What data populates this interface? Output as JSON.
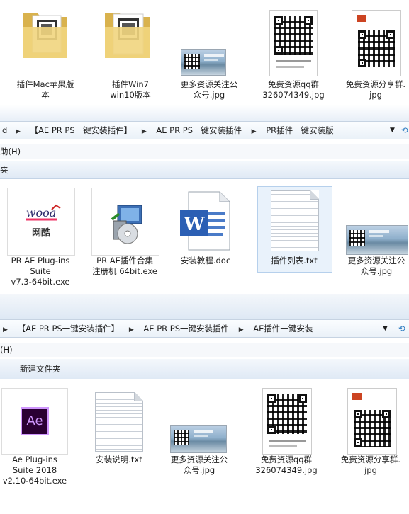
{
  "top": {
    "files": [
      {
        "label": "插件Mac苹果版\n本"
      },
      {
        "label": "插件Win7\nwin10版本"
      },
      {
        "label": "更多资源关注公\n众号.jpg"
      },
      {
        "label": "免费资源qq群\n326074349.jpg"
      },
      {
        "label": "免费资源分享群.\njpg"
      }
    ]
  },
  "mid": {
    "address": {
      "lead": "d",
      "crumbs": [
        "【AE PR PS一键安装插件】",
        "AE PR PS一键安装插件",
        "PR插件一键安装版"
      ]
    },
    "menu_fragment": "助(H)",
    "toolbar_fragment": "夹",
    "files": [
      {
        "label": "PR AE Plug-ins\nSuite\nv7.3-64bit.exe"
      },
      {
        "label": "PR AE插件合集\n注册机 64bit.exe"
      },
      {
        "label": "安装教程.doc"
      },
      {
        "label": "插件列表.txt"
      },
      {
        "label": "更多资源关注公\n众号.jpg"
      }
    ],
    "logo_text": "网酷"
  },
  "bottom": {
    "address": {
      "crumbs": [
        "【AE PR PS一键安装插件】",
        "AE PR PS一键安装插件",
        "AE插件一键安装"
      ]
    },
    "menu_fragment": "(H)",
    "new_folder_label": "新建文件夹",
    "files": [
      {
        "label": "Ae Plug-ins\nSuite 2018\nv2.10-64bit.exe"
      },
      {
        "label": "安装说明.txt"
      },
      {
        "label": "更多资源关注公\n众号.jpg"
      },
      {
        "label": "免费资源qq群\n326074349.jpg"
      },
      {
        "label": "免费资源分享群.\njpg"
      }
    ],
    "ae_icon_text": "Ae"
  },
  "colors": {
    "folder": "#e9c96a",
    "ae_purple": "#2a0033",
    "ae_text": "#cf96fd",
    "word_blue": "#2b5fb4",
    "address_bg": "#eaf1f8"
  }
}
